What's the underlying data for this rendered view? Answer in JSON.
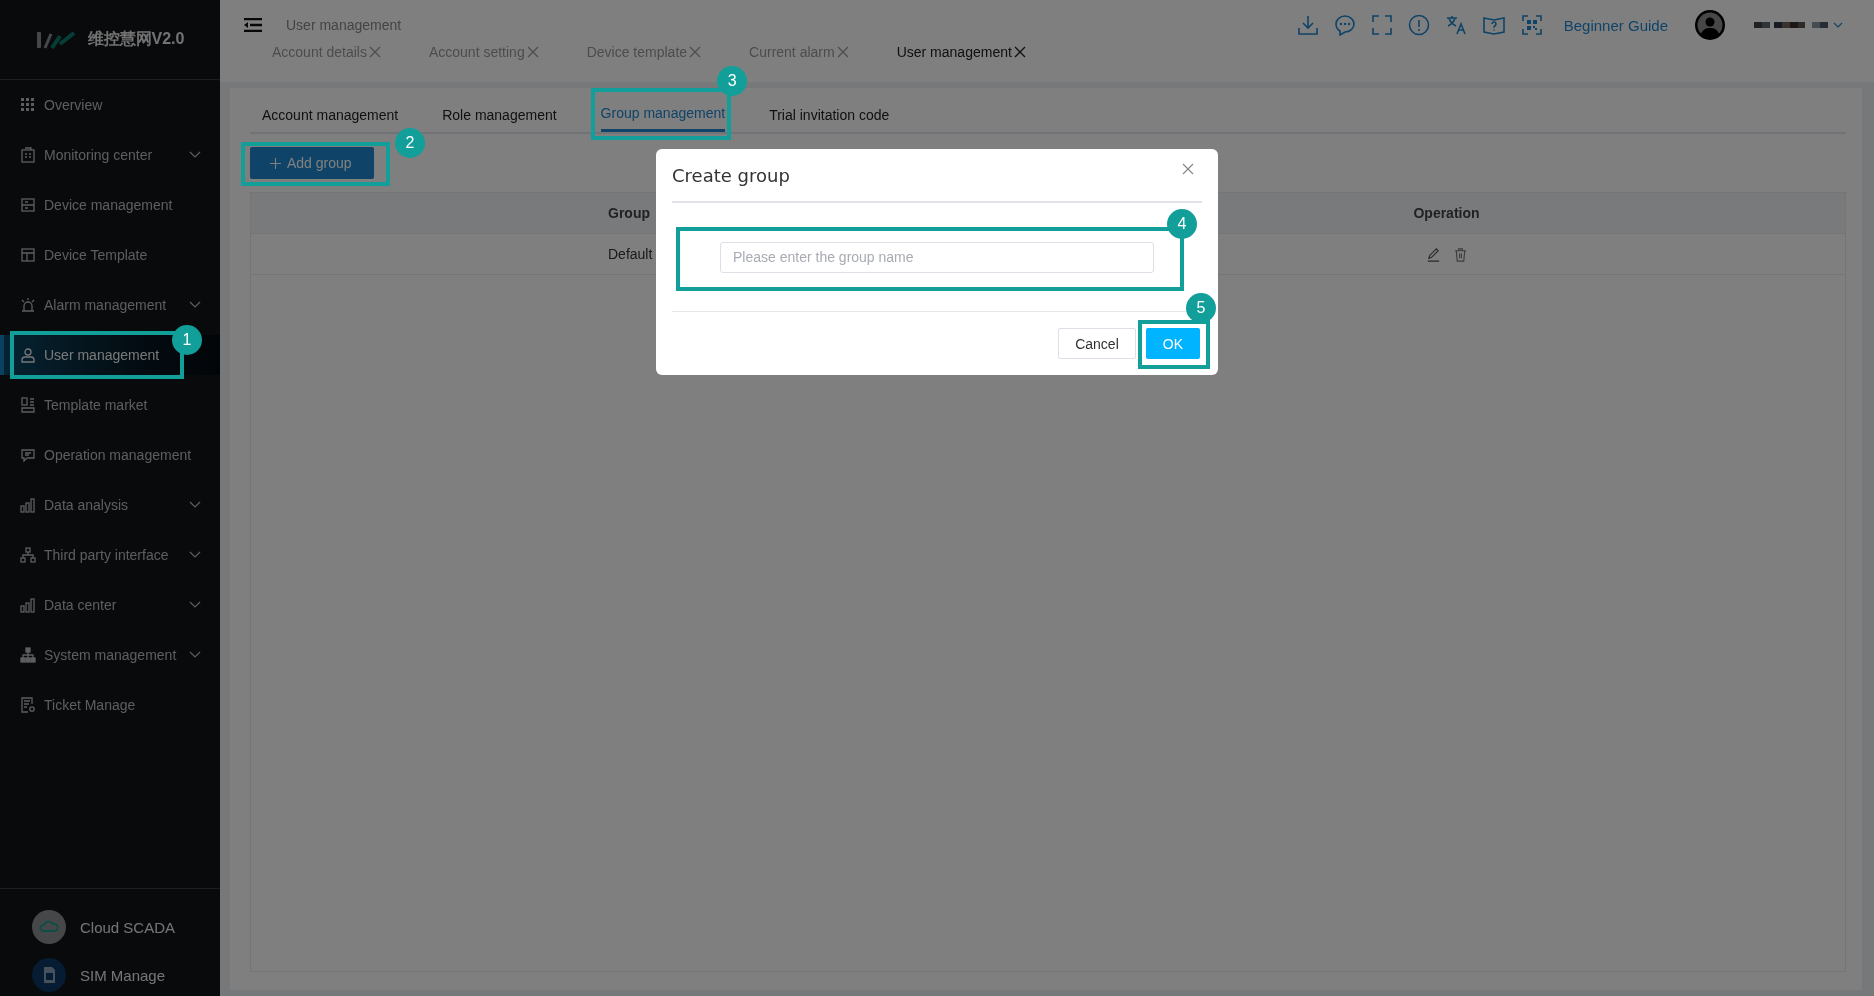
{
  "logo": {
    "text": "维控慧网V2.0"
  },
  "sidebar": {
    "items": [
      {
        "label": "Overview",
        "kind": "grid",
        "expandable": false,
        "selected": false
      },
      {
        "label": "Monitoring center",
        "kind": "building",
        "expandable": true,
        "selected": false
      },
      {
        "label": "Device management",
        "kind": "server",
        "expandable": false,
        "selected": false
      },
      {
        "label": "Device Template",
        "kind": "layout",
        "expandable": false,
        "selected": false
      },
      {
        "label": "Alarm management",
        "kind": "alarm",
        "expandable": true,
        "selected": false
      },
      {
        "label": "User management",
        "kind": "user",
        "expandable": false,
        "selected": true,
        "callout": "1"
      },
      {
        "label": "Template market",
        "kind": "blocks",
        "expandable": false,
        "selected": false
      },
      {
        "label": "Operation management",
        "kind": "chat",
        "expandable": false,
        "selected": false
      },
      {
        "label": "Data analysis",
        "kind": "bars",
        "expandable": true,
        "selected": false
      },
      {
        "label": "Third party interface",
        "kind": "tree",
        "expandable": true,
        "selected": false
      },
      {
        "label": "Data center",
        "kind": "bars",
        "expandable": true,
        "selected": false
      },
      {
        "label": "System management",
        "kind": "org",
        "expandable": true,
        "selected": false
      },
      {
        "label": "Ticket Manage",
        "kind": "ticket",
        "expandable": false,
        "selected": false
      }
    ],
    "footer": [
      {
        "label": "Cloud SCADA",
        "kind": "cloud"
      },
      {
        "label": "SIM Manage",
        "kind": "sim"
      }
    ]
  },
  "header": {
    "breadcrumb": "User management",
    "guide_link": "Beginner Guide"
  },
  "page_tabs": [
    {
      "label": "Account details",
      "selected": false
    },
    {
      "label": "Account setting",
      "selected": false
    },
    {
      "label": "Device template",
      "selected": false
    },
    {
      "label": "Current alarm",
      "selected": false
    },
    {
      "label": "User management",
      "selected": true
    }
  ],
  "sub_tabs": [
    {
      "label": "Account management",
      "selected": false
    },
    {
      "label": "Role management",
      "selected": false
    },
    {
      "label": "Group management",
      "selected": true,
      "callout": "3"
    },
    {
      "label": "Trial invitation code",
      "selected": false
    }
  ],
  "add_button": {
    "label": "Add group",
    "callout": "2"
  },
  "table": {
    "columns": [
      "Group",
      "Operation"
    ],
    "rows": [
      {
        "cells": [
          "Default"
        ]
      }
    ]
  },
  "dialog": {
    "title": "Create group",
    "placeholder": "Please enter the group name",
    "field_callout": "4",
    "buttons": [
      {
        "label": "Cancel",
        "kind": "secondary"
      },
      {
        "label": "OK",
        "kind": "primary",
        "callout": "5"
      }
    ]
  }
}
